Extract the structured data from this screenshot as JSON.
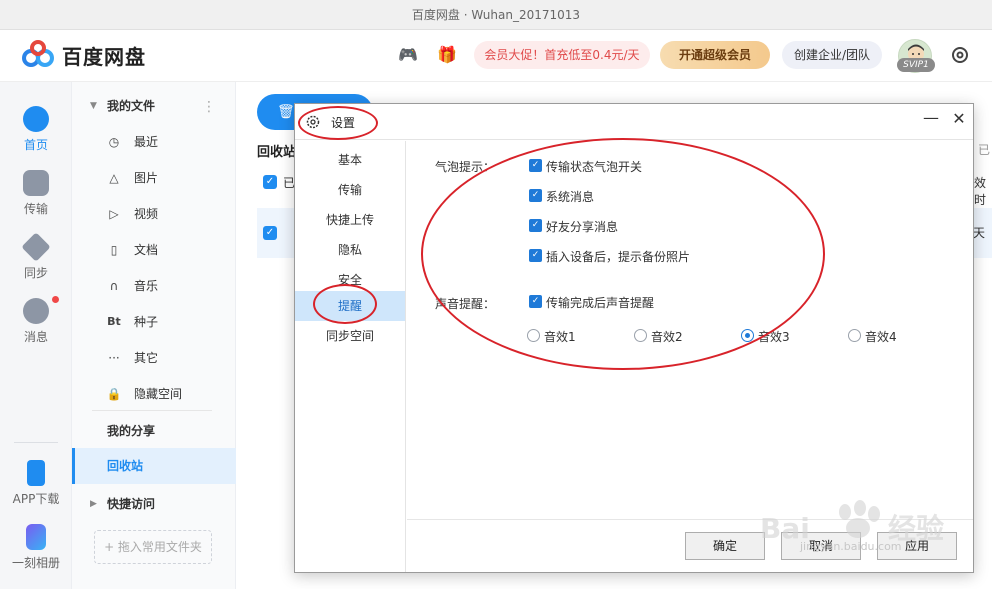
{
  "window": {
    "title": "百度网盘 · Wuhan_20171013"
  },
  "header": {
    "brand": "百度网盘",
    "promo": "会员大促！首充低至0.4元/天",
    "svip_button": "开通超级会员",
    "team_button": "创建企业/团队",
    "avatar_badge": "SVIP1"
  },
  "leftnav": {
    "items": [
      {
        "label": "首页",
        "icon": "cloud-icon",
        "active": true
      },
      {
        "label": "传输",
        "icon": "transfer-icon"
      },
      {
        "label": "同步",
        "icon": "sync-icon"
      },
      {
        "label": "消息",
        "icon": "message-icon"
      }
    ],
    "bottom": [
      {
        "label": "APP下载",
        "icon": "phone-icon"
      },
      {
        "label": "一刻相册",
        "icon": "album-icon"
      }
    ]
  },
  "tree": {
    "my_files": "我的文件",
    "items": [
      {
        "label": "最近",
        "icon": "clock-icon"
      },
      {
        "label": "图片",
        "icon": "image-icon"
      },
      {
        "label": "视频",
        "icon": "play-icon"
      },
      {
        "label": "文档",
        "icon": "doc-icon"
      },
      {
        "label": "音乐",
        "icon": "headphone-icon"
      },
      {
        "label": "种子",
        "icon": "bt-icon"
      },
      {
        "label": "其它",
        "icon": "more-icon"
      },
      {
        "label": "隐藏空间",
        "icon": "lock-icon"
      }
    ],
    "my_share": "我的分享",
    "recycle": "回收站",
    "quick_access": "快捷访问",
    "add_folder": "+ 拖入常用文件夹"
  },
  "main": {
    "recycle_head": "回收站",
    "partial_select": "已",
    "partial_right_top": "已",
    "partial_right_mid": "效时",
    "partial_right_row": "天"
  },
  "dialog": {
    "title": "设置",
    "nav": [
      {
        "label": "基本"
      },
      {
        "label": "传输"
      },
      {
        "label": "快捷上传"
      },
      {
        "label": "隐私"
      },
      {
        "label": "安全"
      },
      {
        "label": "提醒",
        "active": true
      },
      {
        "label": "同步空间"
      }
    ],
    "bubble_label": "气泡提示：",
    "bubble_options": [
      {
        "label": "传输状态气泡开关",
        "checked": true
      },
      {
        "label": "系统消息",
        "checked": true
      },
      {
        "label": "好友分享消息",
        "checked": true
      },
      {
        "label": "插入设备后，提示备份照片",
        "checked": true
      }
    ],
    "sound_label": "声音提醒：",
    "sound_toggle": {
      "label": "传输完成后声音提醒",
      "checked": true
    },
    "sound_effects": [
      {
        "label": "音效1",
        "selected": false
      },
      {
        "label": "音效2",
        "selected": false
      },
      {
        "label": "音效3",
        "selected": true
      },
      {
        "label": "音效4",
        "selected": false
      }
    ],
    "buttons": {
      "ok": "确定",
      "cancel": "取消",
      "apply": "应用"
    }
  },
  "watermark": {
    "brand": "Baidu经验",
    "url": "jingyan.baidu.com"
  },
  "colors": {
    "accent": "#1f8cf0",
    "annotation": "#d8232a",
    "promo": "#e04a4a"
  }
}
